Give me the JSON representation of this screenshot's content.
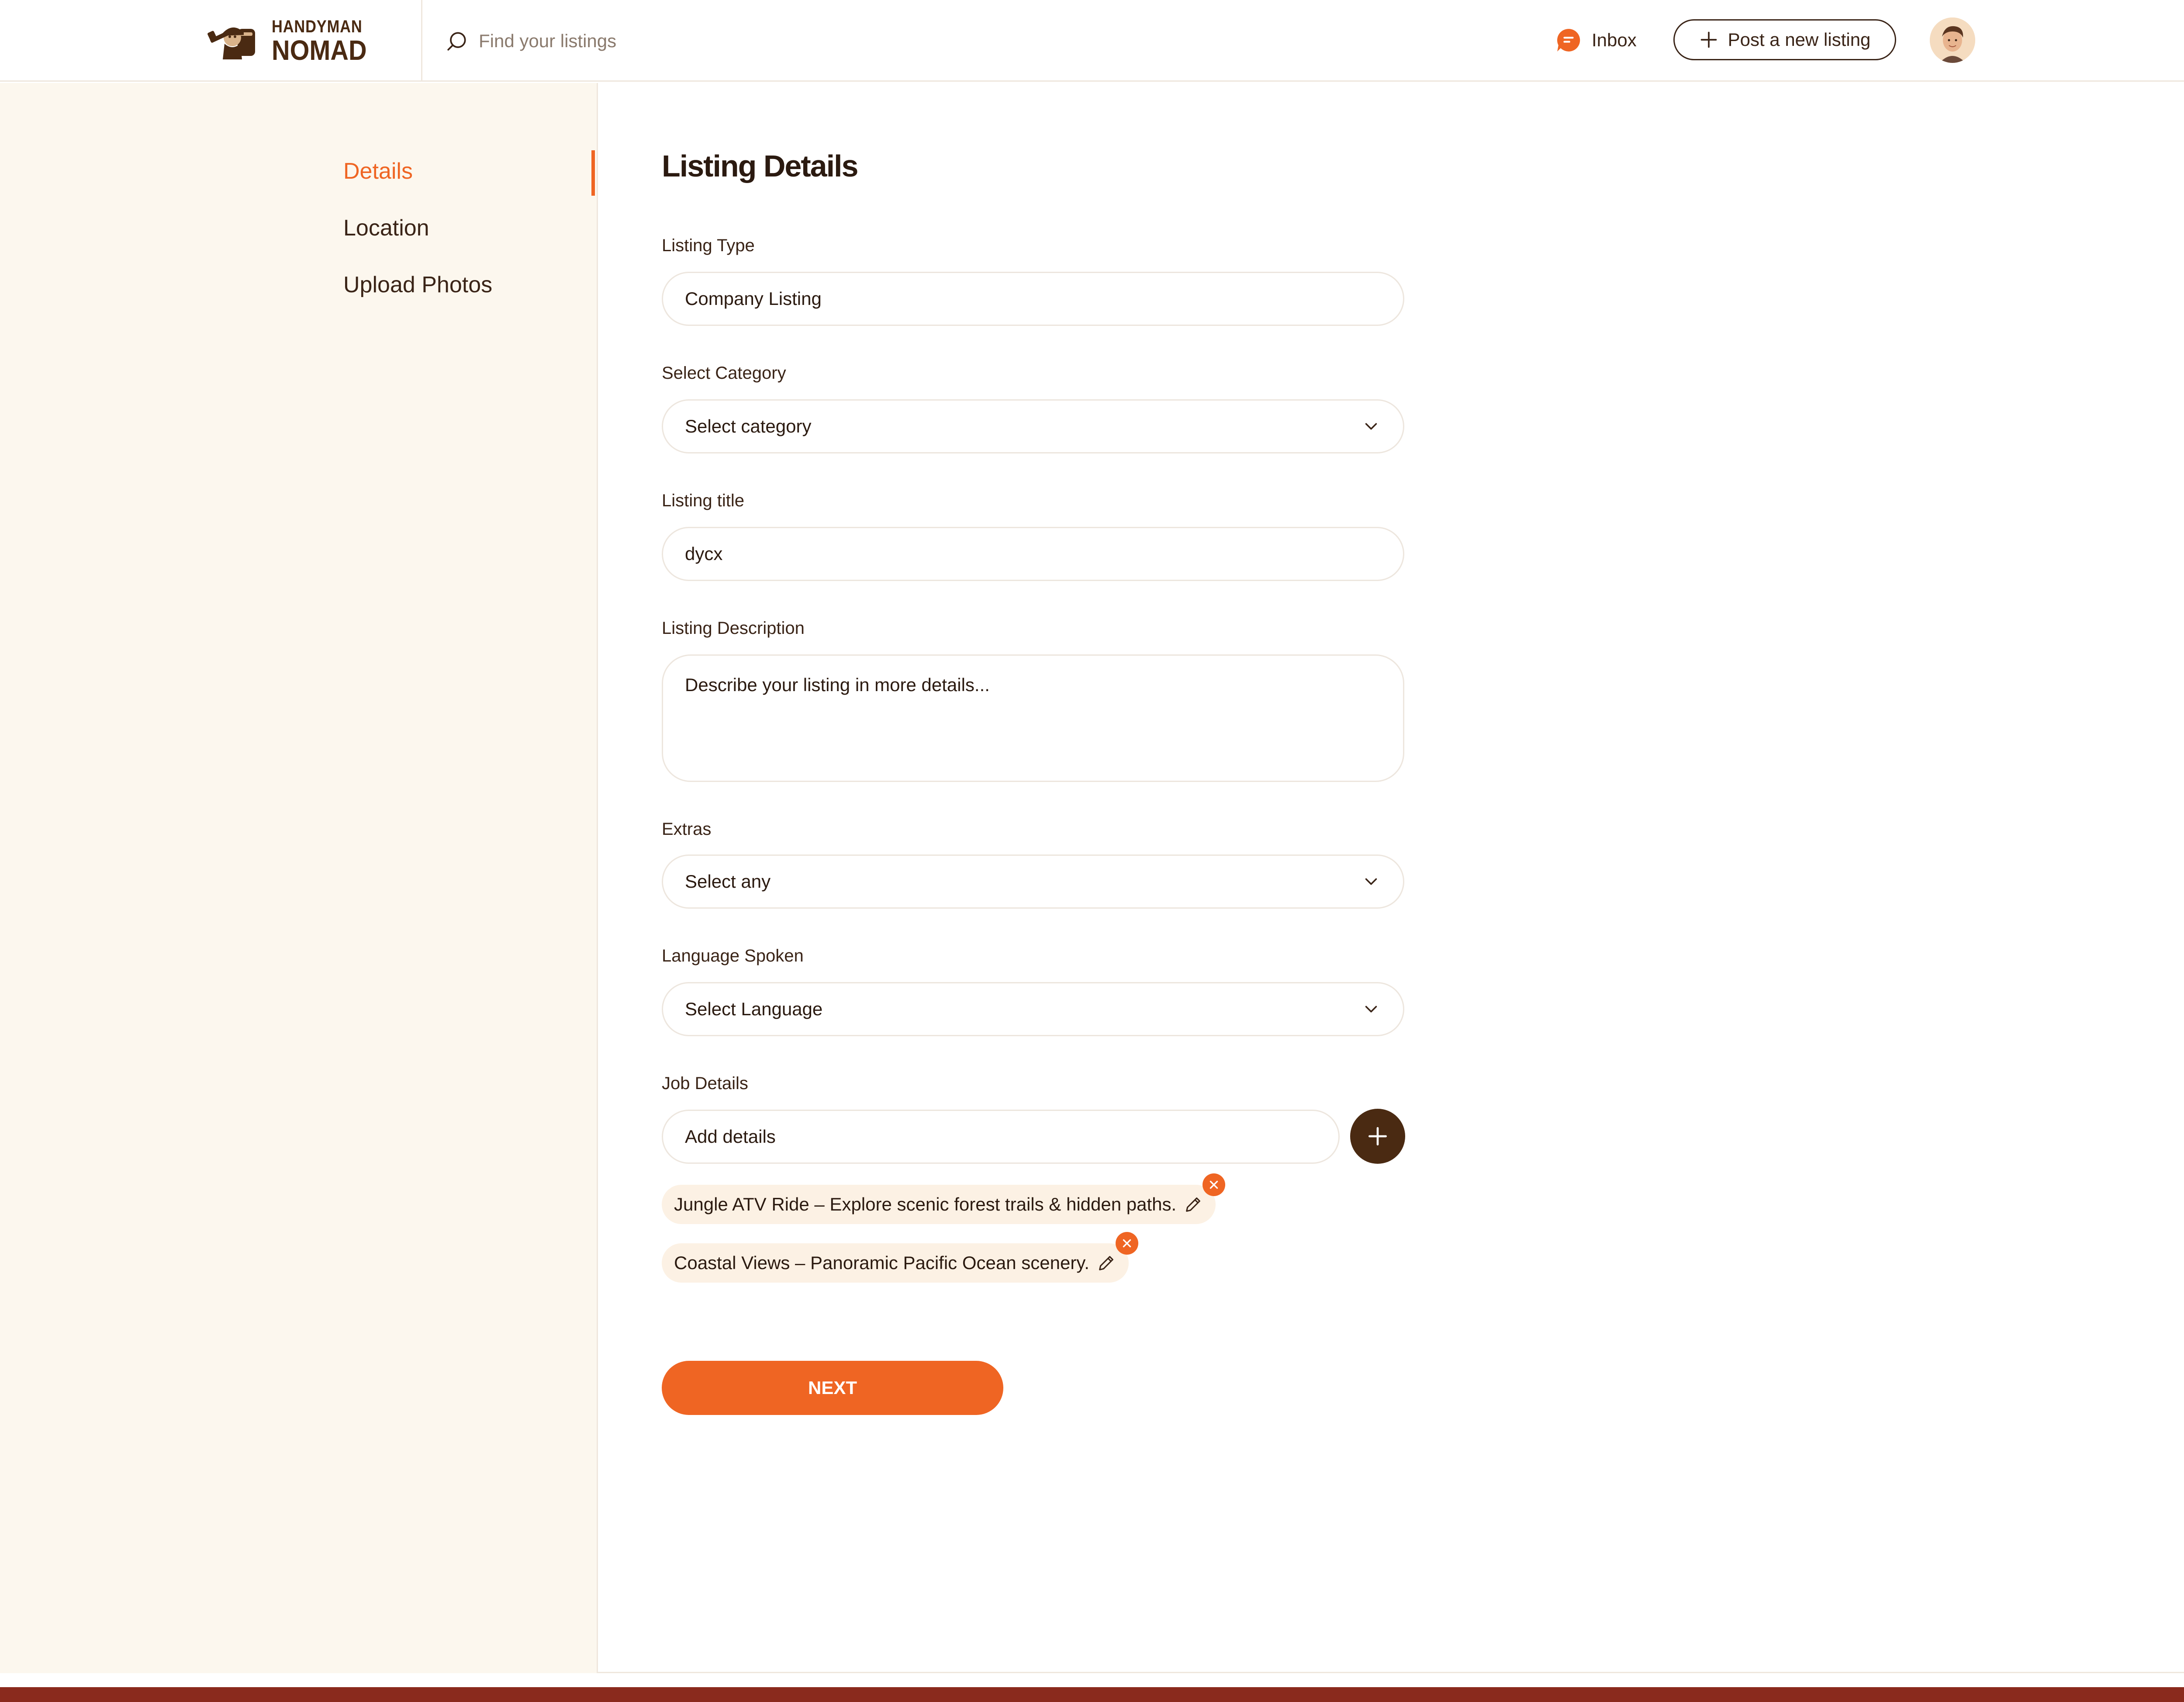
{
  "brand": {
    "name_line1": "HANDYMAN",
    "name_line2": "NOMAD",
    "logo_icon": "handyman-nomad-logo",
    "accent_color": "#ef6523",
    "dark_brown": "#4a2a12",
    "footer_color": "#8a2a1d"
  },
  "header": {
    "search_placeholder": "Find your listings",
    "inbox_label": "Inbox",
    "post_button_label": "Post a new listing"
  },
  "sidebar": {
    "items": [
      {
        "label": "Details",
        "active": true
      },
      {
        "label": "Location",
        "active": false
      },
      {
        "label": "Upload Photos",
        "active": false
      }
    ]
  },
  "form": {
    "title": "Listing Details",
    "listing_type": {
      "label": "Listing Type",
      "value": "Company Listing"
    },
    "category": {
      "label": "Select Category",
      "value": "Select category"
    },
    "listing_title": {
      "label": "Listing title",
      "value": "dycx"
    },
    "description": {
      "label": "Listing Description",
      "placeholder": "Describe your listing in more details..."
    },
    "extras": {
      "label": "Extras",
      "value": "Select any"
    },
    "language": {
      "label": "Language Spoken",
      "value": "Select Language"
    },
    "job_details": {
      "label": "Job Details",
      "placeholder": "Add details",
      "items": [
        "Jungle ATV Ride – Explore scenic forest trails & hidden paths.",
        "Coastal Views – Panoramic Pacific Ocean scenery."
      ]
    },
    "next_label": "NEXT"
  }
}
